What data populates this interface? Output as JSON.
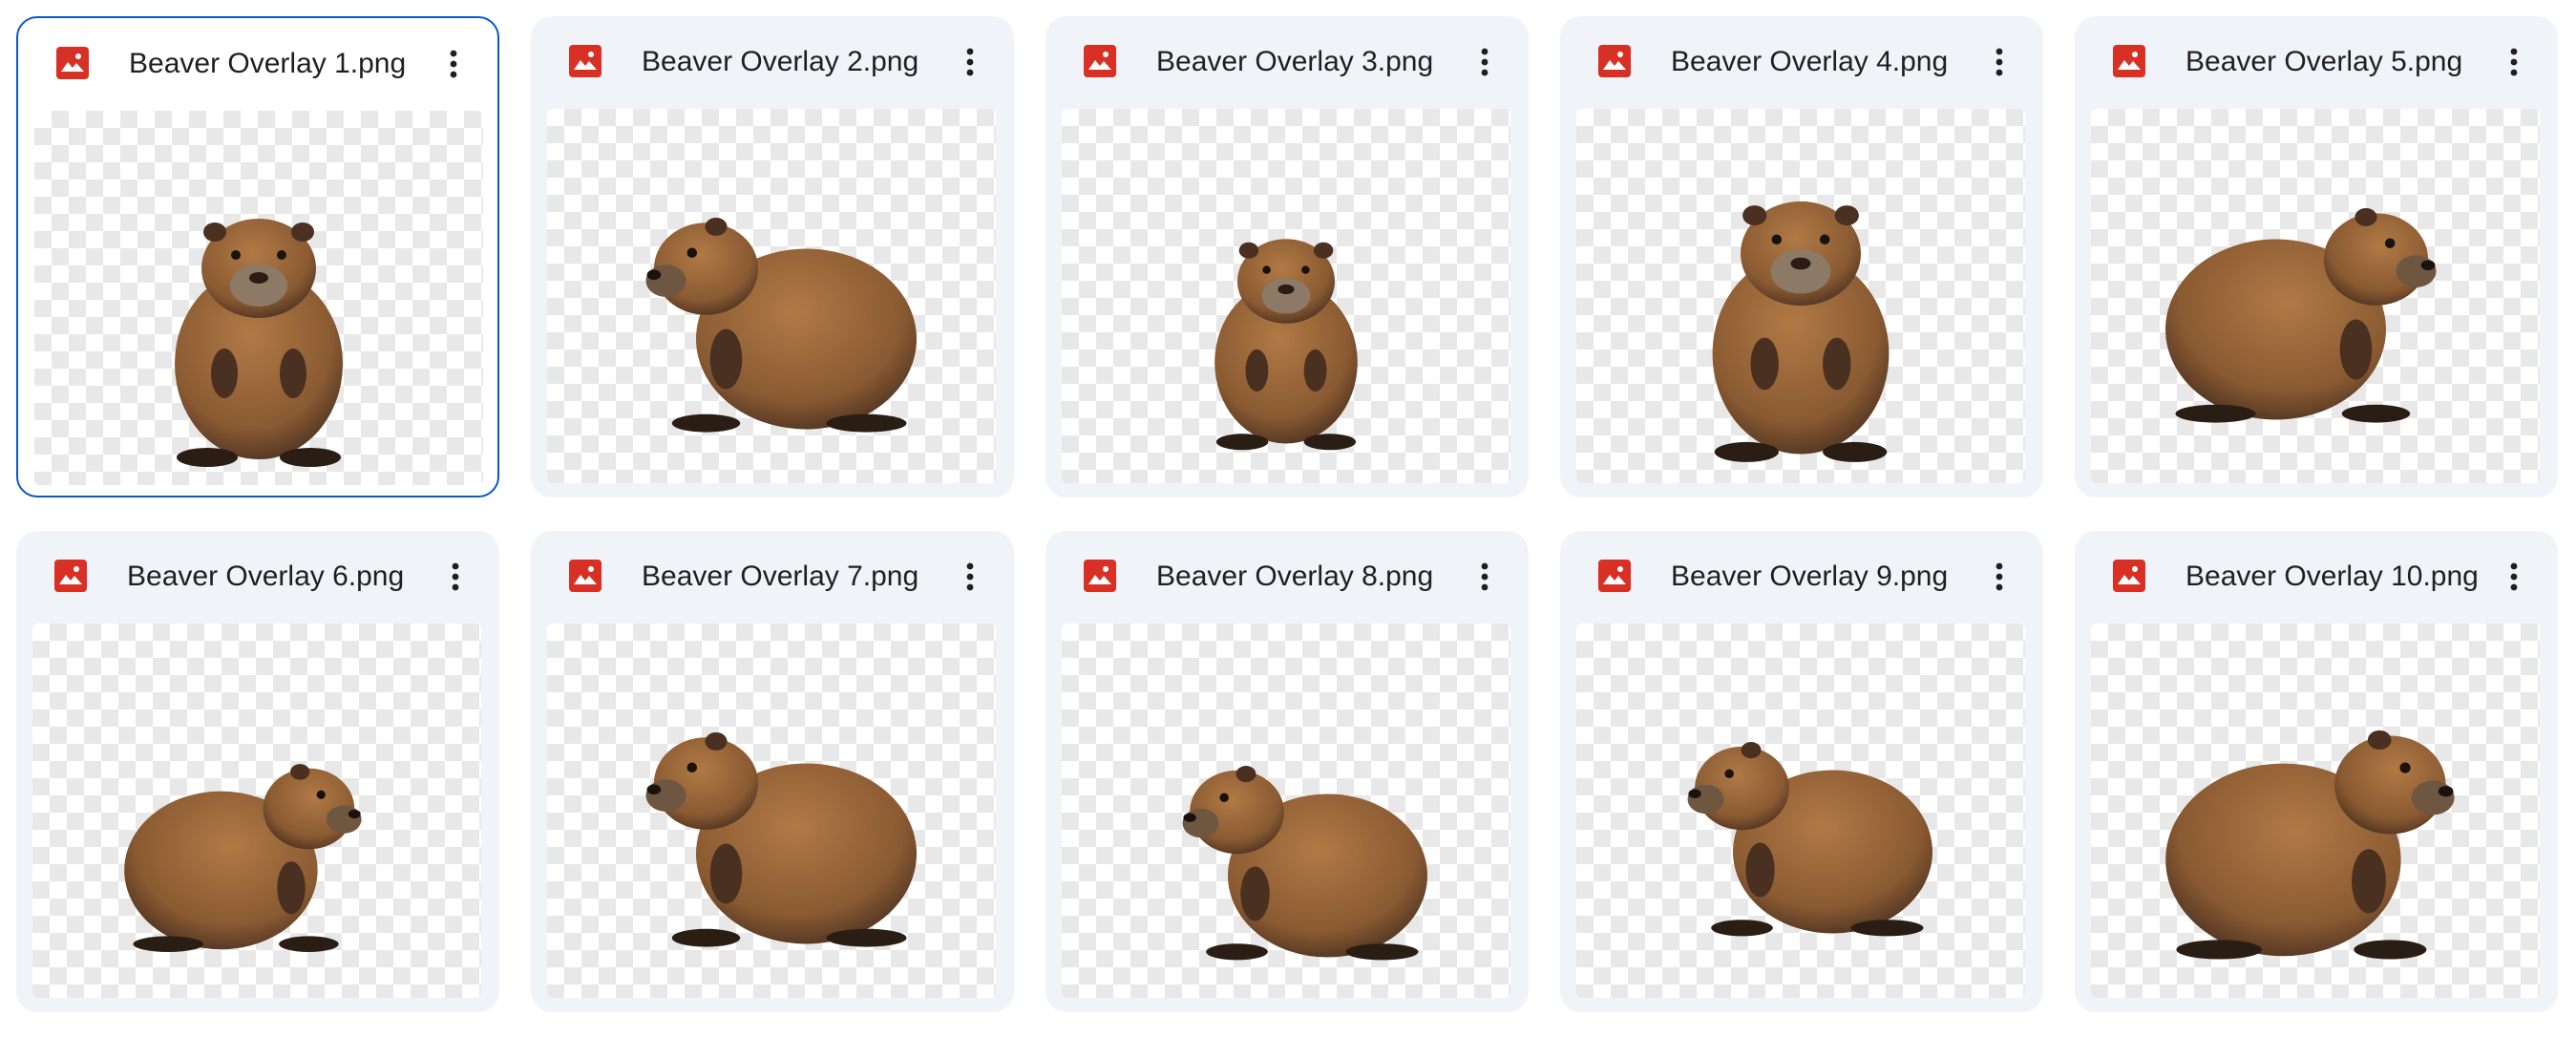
{
  "files": [
    {
      "name": "Beaver Overlay 1.png",
      "selected": true,
      "icon": "image-file-icon",
      "pose": "front-standing"
    },
    {
      "name": "Beaver Overlay 2.png",
      "selected": false,
      "icon": "image-file-icon",
      "pose": "side-sitting-left"
    },
    {
      "name": "Beaver Overlay 3.png",
      "selected": false,
      "icon": "image-file-icon",
      "pose": "front-crouch-small"
    },
    {
      "name": "Beaver Overlay 4.png",
      "selected": false,
      "icon": "image-file-icon",
      "pose": "front-sitting"
    },
    {
      "name": "Beaver Overlay 5.png",
      "selected": false,
      "icon": "image-file-icon",
      "pose": "side-lying-right"
    },
    {
      "name": "Beaver Overlay 6.png",
      "selected": false,
      "icon": "image-file-icon",
      "pose": "side-standing-right"
    },
    {
      "name": "Beaver Overlay 7.png",
      "selected": false,
      "icon": "image-file-icon",
      "pose": "side-sitting-left"
    },
    {
      "name": "Beaver Overlay 8.png",
      "selected": false,
      "icon": "image-file-icon",
      "pose": "side-lying-left"
    },
    {
      "name": "Beaver Overlay 9.png",
      "selected": false,
      "icon": "image-file-icon",
      "pose": "side-standing-left"
    },
    {
      "name": "Beaver Overlay 10.png",
      "selected": false,
      "icon": "image-file-icon",
      "pose": "side-sitting-right"
    }
  ],
  "more_icon": "more-vert-icon",
  "colors": {
    "card_bg": "#f0f4f9",
    "selected_border": "#0b57d0",
    "image_icon": "#d93025",
    "fur_main": "#8a5a32",
    "fur_light": "#b07a45",
    "fur_dark": "#4a3020"
  }
}
